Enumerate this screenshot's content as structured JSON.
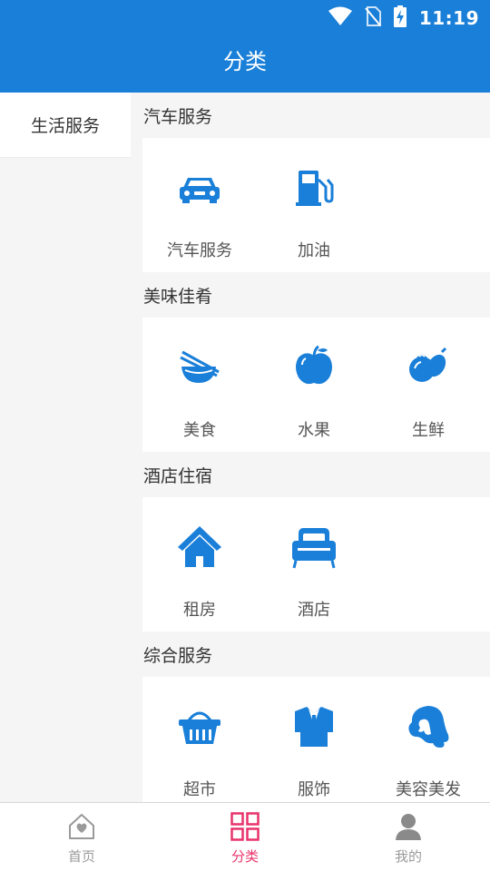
{
  "status_bar": {
    "time": "11:19"
  },
  "header": {
    "title": "分类"
  },
  "sidebar": {
    "items": [
      {
        "label": "生活服务"
      }
    ]
  },
  "sections": [
    {
      "title": "汽车服务",
      "items": [
        {
          "label": "汽车服务",
          "icon": "car-icon"
        },
        {
          "label": "加油",
          "icon": "gas-pump-icon"
        }
      ]
    },
    {
      "title": "美味佳肴",
      "items": [
        {
          "label": "美食",
          "icon": "bowl-chopsticks-icon"
        },
        {
          "label": "水果",
          "icon": "apple-icon"
        },
        {
          "label": "生鲜",
          "icon": "vegetables-icon"
        }
      ]
    },
    {
      "title": "酒店住宿",
      "items": [
        {
          "label": "租房",
          "icon": "house-icon"
        },
        {
          "label": "酒店",
          "icon": "bed-icon"
        }
      ]
    },
    {
      "title": "综合服务",
      "items": [
        {
          "label": "超市",
          "icon": "basket-icon"
        },
        {
          "label": "服饰",
          "icon": "suit-icon"
        },
        {
          "label": "美容美发",
          "icon": "woman-hair-icon"
        }
      ]
    }
  ],
  "bottom_nav": {
    "items": [
      {
        "label": "首页",
        "icon": "home-heart-icon"
      },
      {
        "label": "分类",
        "icon": "grid-icon",
        "active": true
      },
      {
        "label": "我的",
        "icon": "user-icon"
      }
    ]
  },
  "colors": {
    "primary": "#1a7fd8",
    "active_tab": "#e8336b",
    "inactive_tab": "#9a9a9a"
  }
}
